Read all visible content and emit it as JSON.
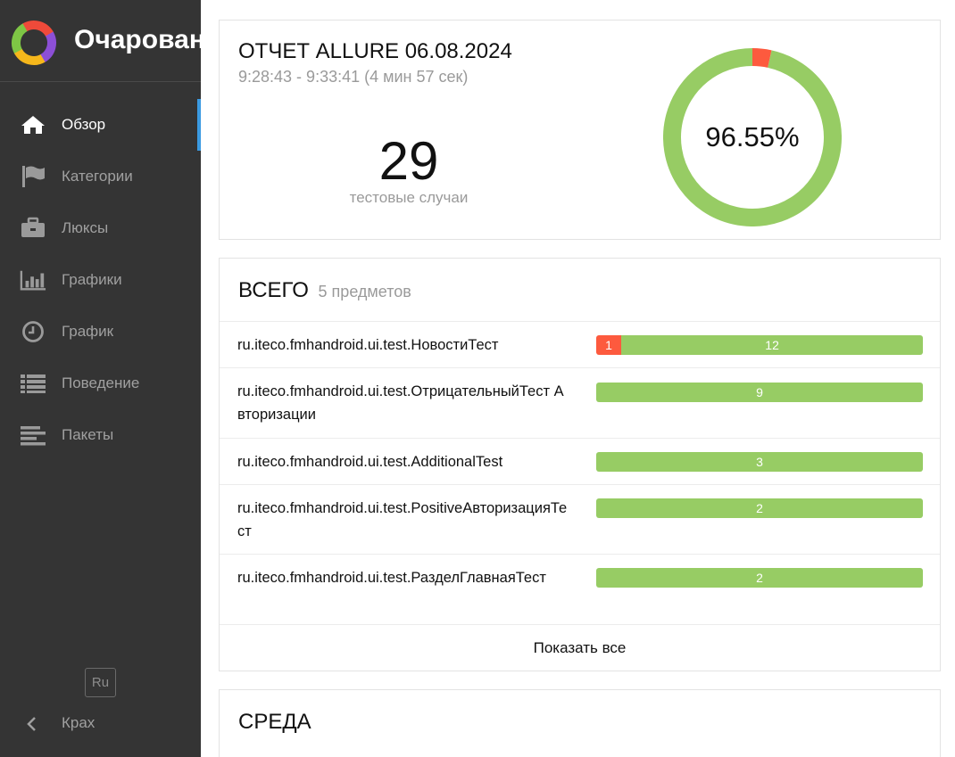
{
  "brand": {
    "title": "Очарование"
  },
  "nav": {
    "items": [
      {
        "label": "Обзор",
        "icon": "home-icon"
      },
      {
        "label": "Категории",
        "icon": "flag-icon"
      },
      {
        "label": "Люксы",
        "icon": "briefcase-icon"
      },
      {
        "label": "Графики",
        "icon": "bar-chart-icon"
      },
      {
        "label": "График",
        "icon": "clock-icon"
      },
      {
        "label": "Поведение",
        "icon": "list-icon"
      },
      {
        "label": "Пакеты",
        "icon": "align-left-icon"
      }
    ],
    "active": "Обзор"
  },
  "footer": {
    "language": "Ru",
    "collapse_label": "Крах"
  },
  "summary": {
    "title": "ОТЧЕТ ALLURE 06.08.2024",
    "time_range": "9:28:43 - 9:33:41 (4 мин 57 сек)",
    "test_count": "29",
    "test_count_label": "тестовые случаи",
    "pass_rate": "96.55%",
    "passed": 28,
    "failed": 1
  },
  "suites": {
    "title": "ВСЕГО",
    "subtitle": "5 предметов",
    "rows": [
      {
        "name": "ru.iteco.fmhandroid.ui.test.НовостиТест",
        "failed": "1",
        "passed": "12"
      },
      {
        "name": "ru.iteco.fmhandroid.ui.test.ОтрицательныйТест Авторизации",
        "failed": "",
        "passed": "9"
      },
      {
        "name": "ru.iteco.fmhandroid.ui.test.AdditionalTest",
        "failed": "",
        "passed": "3"
      },
      {
        "name": "ru.iteco.fmhandroid.ui.test.PositiveАвторизацияТест",
        "failed": "",
        "passed": "2"
      },
      {
        "name": "ru.iteco.fmhandroid.ui.test.РазделГлавнаяТест",
        "failed": "",
        "passed": "2"
      }
    ],
    "show_all": "Показать все"
  },
  "environment": {
    "title": "СРЕДА"
  },
  "colors": {
    "passed": "#97cc64",
    "failed": "#fd5a3e",
    "sidebar": "#343434",
    "active_marker": "#3b9ae1"
  }
}
